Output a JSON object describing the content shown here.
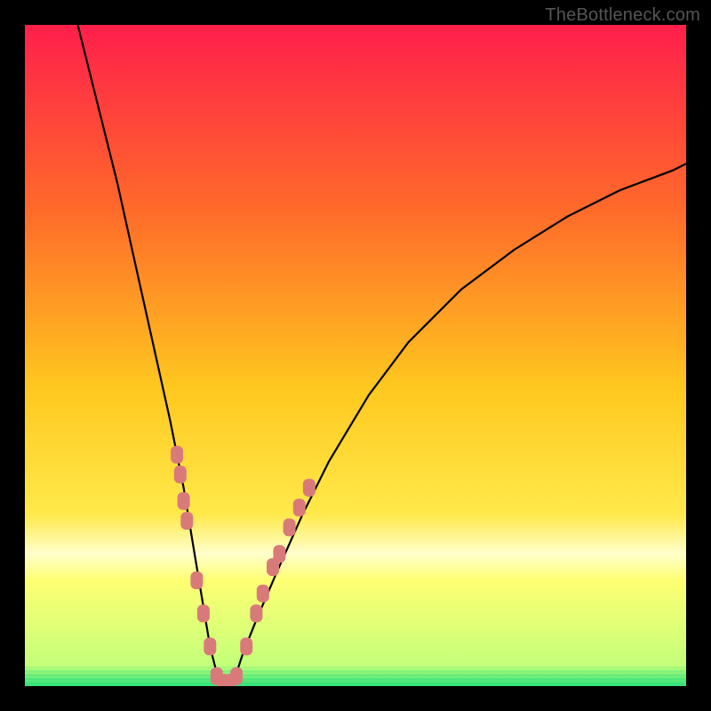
{
  "watermark": "TheBottleneck.com",
  "colors": {
    "frame": "#000000",
    "gradient_top": "#ff1f4b",
    "gradient_mid1": "#ff7a1f",
    "gradient_mid2": "#ffd21f",
    "gradient_mid3": "#ffff66",
    "gradient_bottom_band": "#ffffcc",
    "gradient_bottom": "#33e27a",
    "curve": "#000000",
    "dot_fill": "#d97a7a",
    "dot_stroke": "#b85a5a"
  },
  "chart_data": {
    "type": "line",
    "title": "",
    "xlabel": "",
    "ylabel": "",
    "xlim": [
      0,
      100
    ],
    "ylim": [
      0,
      100
    ],
    "grid": false,
    "legend": false,
    "series": [
      {
        "name": "bottleneck-curve",
        "x": [
          8,
          10,
          12,
          14,
          16,
          18,
          20,
          22,
          24,
          25,
          26,
          27,
          28,
          29,
          30,
          31,
          32,
          33,
          35,
          38,
          42,
          46,
          52,
          58,
          66,
          74,
          82,
          90,
          98,
          100
        ],
        "y": [
          100,
          92,
          84,
          76,
          67,
          58,
          49,
          40,
          30,
          24,
          18,
          12,
          6,
          2,
          0,
          0,
          2,
          5,
          10,
          17,
          26,
          34,
          44,
          52,
          60,
          66,
          71,
          75,
          78,
          79
        ]
      }
    ],
    "scatter_points": {
      "name": "sample-dots",
      "points": [
        {
          "x": 23.0,
          "y": 35
        },
        {
          "x": 23.5,
          "y": 32
        },
        {
          "x": 24.0,
          "y": 28
        },
        {
          "x": 24.5,
          "y": 25
        },
        {
          "x": 26.0,
          "y": 16
        },
        {
          "x": 27.0,
          "y": 11
        },
        {
          "x": 28.0,
          "y": 6
        },
        {
          "x": 29.0,
          "y": 1.5
        },
        {
          "x": 30.0,
          "y": 0.5
        },
        {
          "x": 31.0,
          "y": 0.5
        },
        {
          "x": 32.0,
          "y": 1.5
        },
        {
          "x": 33.5,
          "y": 6
        },
        {
          "x": 35.0,
          "y": 11
        },
        {
          "x": 36.0,
          "y": 14
        },
        {
          "x": 37.5,
          "y": 18
        },
        {
          "x": 38.5,
          "y": 20
        },
        {
          "x": 40.0,
          "y": 24
        },
        {
          "x": 41.5,
          "y": 27
        },
        {
          "x": 43.0,
          "y": 30
        }
      ]
    },
    "bottom_green_band_yrange": [
      0,
      3
    ],
    "pale_band_yrange": [
      18,
      24
    ]
  }
}
